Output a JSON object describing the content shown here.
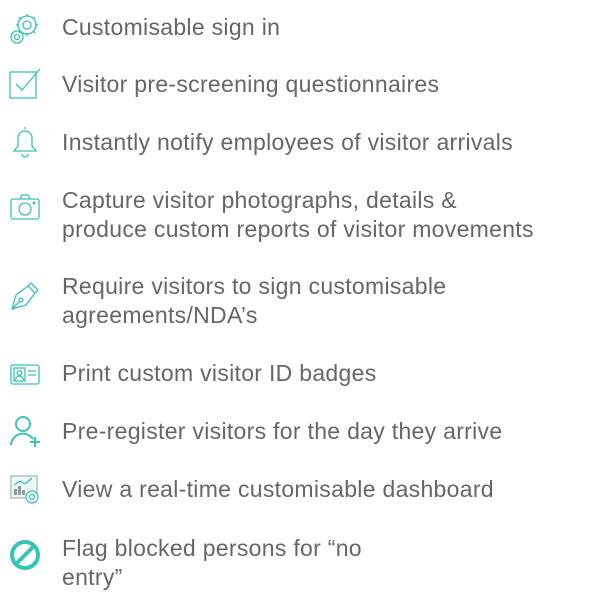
{
  "features": [
    {
      "icon": "gear-icon",
      "lines": [
        "Customisable sign in"
      ]
    },
    {
      "icon": "checkbox-icon",
      "lines": [
        "Visitor pre-screening questionnaires"
      ]
    },
    {
      "icon": "bell-icon",
      "lines": [
        "Instantly notify employees of visitor arrivals"
      ]
    },
    {
      "icon": "camera-icon",
      "lines": [
        "Capture visitor photographs, details &",
        "produce custom reports of visitor movements"
      ]
    },
    {
      "icon": "pen-nib-icon",
      "lines": [
        "Require visitors to sign customisable",
        "agreements/NDA’s"
      ]
    },
    {
      "icon": "id-badge-icon",
      "lines": [
        "Print custom visitor ID badges"
      ]
    },
    {
      "icon": "add-user-icon",
      "lines": [
        "Pre-register visitors for the day they arrive"
      ]
    },
    {
      "icon": "dashboard-icon",
      "lines": [
        "View a real-time customisable dashboard"
      ]
    },
    {
      "icon": "blocked-icon",
      "lines": [
        "Flag blocked persons for “no",
        "entry”"
      ]
    }
  ],
  "colors": {
    "icon_accent": "#38c3b8",
    "text": "#666666"
  }
}
